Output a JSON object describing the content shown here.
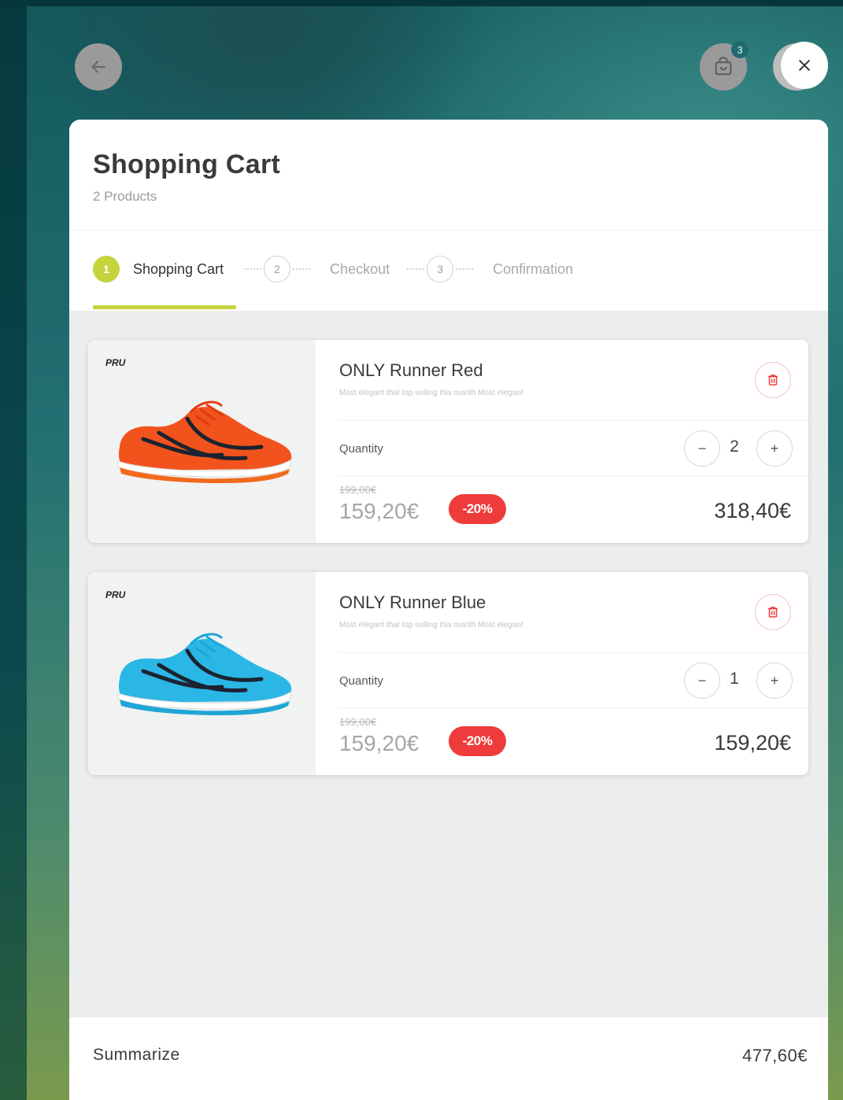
{
  "header": {
    "title": "Shopping Cart",
    "subtitle": "2 Products",
    "cart_badge_count": "3"
  },
  "steps": [
    {
      "number": "1",
      "label": "Shopping Cart",
      "active": true
    },
    {
      "number": "2",
      "label": "Checkout",
      "active": false
    },
    {
      "number": "3",
      "label": "Confirmation",
      "active": false
    }
  ],
  "products": [
    {
      "brand": "PRU",
      "name": "ONLY Runner Red",
      "description": "Most elegant that top selling this month Most elegant",
      "quantity_label": "Quantity",
      "quantity": "2",
      "old_price": "199,00€",
      "price": "159,20€",
      "discount": "-20%",
      "total": "318,40€",
      "color": "#f2531d"
    },
    {
      "brand": "PRU",
      "name": "ONLY Runner Blue",
      "description": "Most elegant that top selling this month Most elegant",
      "quantity_label": "Quantity",
      "quantity": "1",
      "old_price": "199,00€",
      "price": "159,20€",
      "discount": "-20%",
      "total": "159,20€",
      "color": "#2bb7e6"
    }
  ],
  "summary": {
    "label": "Summarize",
    "value": "477,60€"
  },
  "icons": {
    "back": "arrow-left-icon",
    "cart": "cart-icon",
    "close": "close-icon",
    "trash": "trash-icon"
  },
  "colors": {
    "accent": "#c5d33d",
    "discount": "#ee3b3b"
  }
}
